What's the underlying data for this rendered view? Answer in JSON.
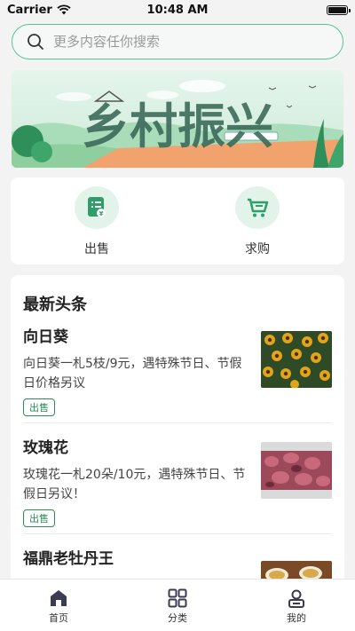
{
  "status_bar": {
    "carrier": "Carrier",
    "time": "10:48 AM"
  },
  "search": {
    "placeholder": "更多内容任你搜索"
  },
  "banner": {
    "title": "乡村振兴",
    "colors": {
      "sky": "#d7efe0",
      "ground": "#f2a26c"
    }
  },
  "quick_actions": [
    {
      "label": "出售",
      "icon": "sell-list-icon"
    },
    {
      "label": "求购",
      "icon": "shopping-cart-icon"
    }
  ],
  "news": {
    "title": "最新头条",
    "items": [
      {
        "title": "向日葵",
        "desc": "向日葵一札5枝/9元，遇特殊节日、节假日价格另议",
        "tag": "出售",
        "image": "sunflowers"
      },
      {
        "title": "玫瑰花",
        "desc": "玫瑰花一札20朵/10元，遇特殊节日、节假日另议！",
        "tag": "出售",
        "image": "roses"
      },
      {
        "title": "福鼎老牡丹王",
        "desc": "",
        "tag": "",
        "image": "tea"
      }
    ]
  },
  "tabbar": [
    {
      "label": "首页",
      "icon": "home-icon",
      "active": true
    },
    {
      "label": "分类",
      "icon": "category-grid-icon",
      "active": false
    },
    {
      "label": "我的",
      "icon": "profile-icon",
      "active": false
    }
  ],
  "colors": {
    "accent": "#56c493",
    "tag": "#2e8b57",
    "icon_bg": "#e2f4ea"
  }
}
